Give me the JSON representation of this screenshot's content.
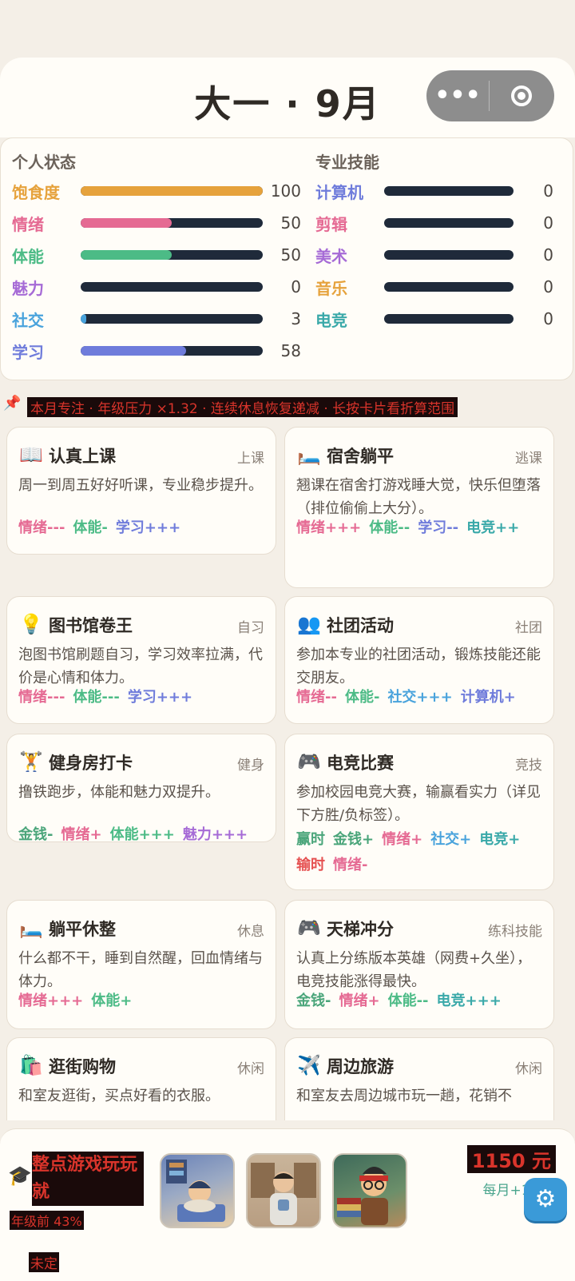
{
  "header": {
    "title": "大一 · 9月"
  },
  "capsule": {
    "more_icon": "more-dots-icon",
    "close_icon": "target-icon"
  },
  "personal": {
    "heading": "个人状态",
    "stats": [
      {
        "label": "饱食度",
        "value": "100",
        "pct": 1.0,
        "color": "#e6a23c",
        "label_color": "#e6a23c"
      },
      {
        "label": "情绪",
        "value": "50",
        "pct": 0.5,
        "color": "#e56a93",
        "label_color": "#e56a93"
      },
      {
        "label": "体能",
        "value": "50",
        "pct": 0.5,
        "color": "#4cbb86",
        "label_color": "#4cbb86"
      },
      {
        "label": "魅力",
        "value": "0",
        "pct": 0.0,
        "color": "#a66bd6",
        "label_color": "#a66bd6"
      },
      {
        "label": "社交",
        "value": "3",
        "pct": 0.03,
        "color": "#49a3dc",
        "label_color": "#49a3dc"
      },
      {
        "label": "学习",
        "value": "58",
        "pct": 0.58,
        "color": "#6f7cdb",
        "label_color": "#6f7cdb"
      }
    ]
  },
  "skills": {
    "heading": "专业技能",
    "stats": [
      {
        "label": "计算机",
        "value": "0",
        "label_color": "#6f7cdb"
      },
      {
        "label": "剪辑",
        "value": "0",
        "label_color": "#e56a93"
      },
      {
        "label": "美术",
        "value": "0",
        "label_color": "#a66bd6"
      },
      {
        "label": "音乐",
        "value": "0",
        "label_color": "#e6a23c"
      },
      {
        "label": "电竞",
        "value": "0",
        "label_color": "#3aa9a9"
      }
    ]
  },
  "notice": {
    "text": "本月专注 · 年级压力 ×1.32 · 连续休息恢复递减 · 长按卡片看折算范围"
  },
  "cards": [
    {
      "title": "认真上课",
      "tag": "上课",
      "icon": "📖",
      "desc": "周一到周五好好听课，专业稳步提升。",
      "effects": [
        {
          "t": "情绪---",
          "c": "#e56a93"
        },
        {
          "t": "体能-",
          "c": "#4cbb86"
        },
        {
          "t": "学习+++",
          "c": "#6f7cdb"
        }
      ]
    },
    {
      "title": "宿舍躺平",
      "tag": "逃课",
      "icon": "🛏️",
      "desc": "翘课在宿舍打游戏睡大觉，快乐但堕落（排位偷偷上大分）。",
      "effects": [
        {
          "t": "情绪+++",
          "c": "#e56a93"
        },
        {
          "t": "体能--",
          "c": "#4cbb86"
        },
        {
          "t": "学习--",
          "c": "#6f7cdb"
        },
        {
          "t": "电竞++",
          "c": "#3aa9a9"
        }
      ]
    },
    {
      "title": "图书馆卷王",
      "tag": "自习",
      "icon": "💡",
      "desc": "泡图书馆刷题自习，学习效率拉满，代价是心情和体力。",
      "effects": [
        {
          "t": "情绪---",
          "c": "#e56a93"
        },
        {
          "t": "体能---",
          "c": "#4cbb86"
        },
        {
          "t": "学习+++",
          "c": "#6f7cdb"
        }
      ]
    },
    {
      "title": "社团活动",
      "tag": "社团",
      "icon": "👥",
      "desc": "参加本专业的社团活动，锻炼技能还能交朋友。",
      "effects": [
        {
          "t": "情绪--",
          "c": "#e56a93"
        },
        {
          "t": "体能-",
          "c": "#4cbb86"
        },
        {
          "t": "社交+++",
          "c": "#49a3dc"
        },
        {
          "t": "计算机+",
          "c": "#6f7cdb"
        }
      ]
    },
    {
      "title": "健身房打卡",
      "tag": "健身",
      "icon": "🏋️",
      "desc": "撸铁跑步，体能和魅力双提升。",
      "effects": [
        {
          "t": "金钱-",
          "c": "#4aa57a"
        },
        {
          "t": "情绪+",
          "c": "#e56a93"
        },
        {
          "t": "体能+++",
          "c": "#4cbb86"
        },
        {
          "t": "魅力+++",
          "c": "#a66bd6"
        }
      ]
    },
    {
      "title": "电竞比赛",
      "tag": "竞技",
      "icon": "🎮",
      "desc": "参加校园电竞大赛，输赢看实力（详见下方胜/负标签）。",
      "effects_win_label": "赢时",
      "effects_lose_label": "输时",
      "effects": [
        {
          "t": "金钱+",
          "c": "#4aa57a"
        },
        {
          "t": "情绪+",
          "c": "#e56a93"
        },
        {
          "t": "社交+",
          "c": "#49a3dc"
        },
        {
          "t": "电竞+",
          "c": "#3aa9a9"
        }
      ],
      "effects_lose": [
        {
          "t": "情绪-",
          "c": "#e56a93"
        }
      ]
    },
    {
      "title": "躺平休整",
      "tag": "休息",
      "icon": "🛏️",
      "desc": "什么都不干，睡到自然醒，回血情绪与体力。",
      "effects": [
        {
          "t": "情绪+++",
          "c": "#e56a93"
        },
        {
          "t": "体能+",
          "c": "#4cbb86"
        }
      ]
    },
    {
      "title": "天梯冲分",
      "tag": "练科技能",
      "icon": "🎮",
      "desc": "认真上分练版本英雄（网费+久坐），电竞技能涨得最快。",
      "effects": [
        {
          "t": "金钱-",
          "c": "#4aa57a"
        },
        {
          "t": "情绪+",
          "c": "#e56a93"
        },
        {
          "t": "体能--",
          "c": "#4cbb86"
        },
        {
          "t": "电竞+++",
          "c": "#3aa9a9"
        }
      ]
    },
    {
      "title": "逛街购物",
      "tag": "休闲",
      "icon": "🛍️",
      "desc": "和室友逛街，买点好看的衣服。",
      "effects": []
    },
    {
      "title": "周边旅游",
      "tag": "休闲",
      "icon": "✈️",
      "desc": "和室友去周边城市玩一趟，花销不",
      "effects": []
    }
  ],
  "bottom": {
    "title": "整点游戏玩玩就",
    "rank": "年级前 43%",
    "status": "未定",
    "money": "1150 元",
    "monthly": "每月+1150",
    "settings_icon": "gear-icon"
  }
}
